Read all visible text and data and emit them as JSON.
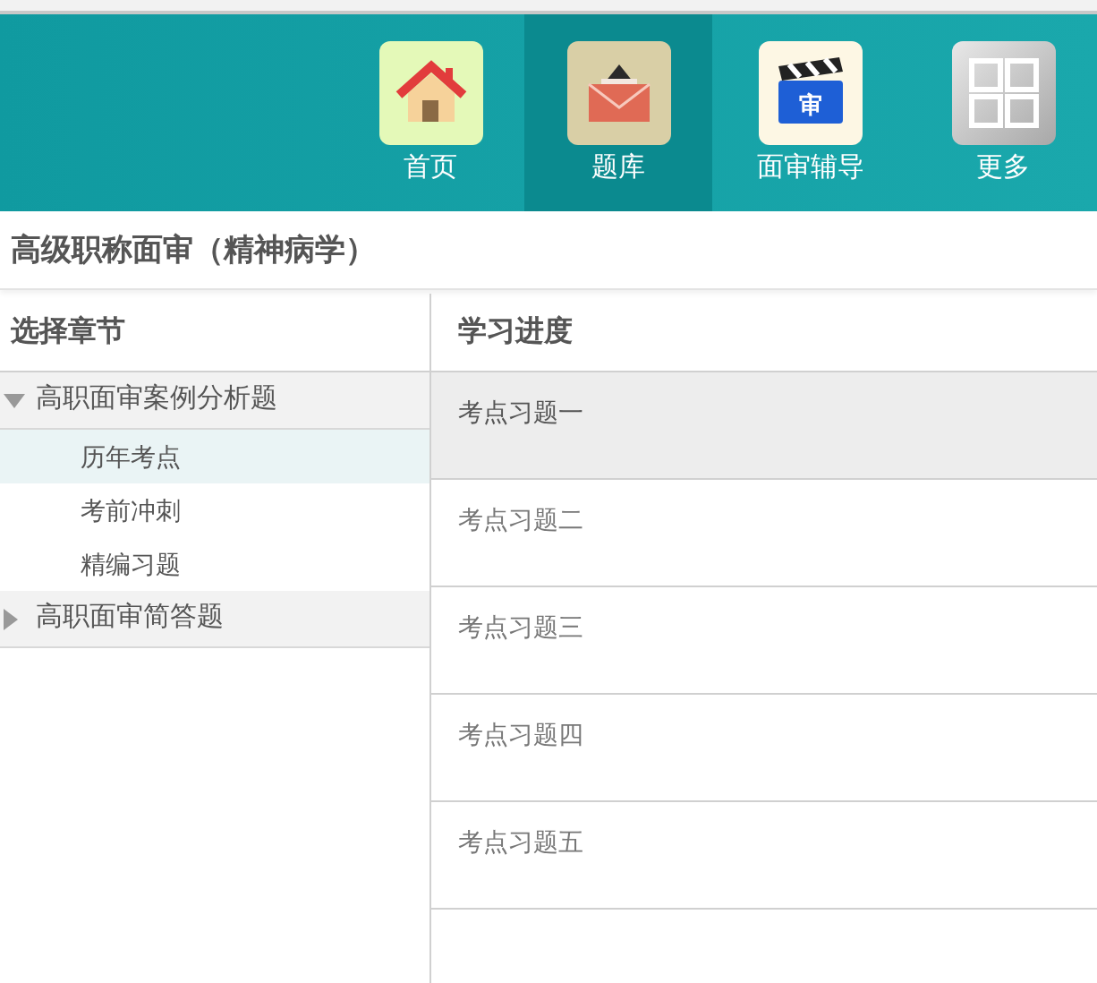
{
  "nav": [
    {
      "kind": "home",
      "label": "首页",
      "selected": false
    },
    {
      "kind": "mail",
      "label": "题库",
      "selected": true
    },
    {
      "kind": "video",
      "label": "面审辅导",
      "selected": false,
      "icon_text": "审"
    },
    {
      "kind": "more",
      "label": "更多",
      "selected": false
    }
  ],
  "title": "高级职称面审（精神病学）",
  "chapters": {
    "header": "选择章节",
    "items": [
      {
        "label": "高职面审案例分析题",
        "expanded": true,
        "children": [
          {
            "label": "历年考点",
            "selected": true
          },
          {
            "label": "考前冲刺",
            "selected": false
          },
          {
            "label": "精编习题",
            "selected": false
          }
        ]
      },
      {
        "label": "高职面审简答题",
        "expanded": false
      }
    ]
  },
  "progress": {
    "header": "学习进度",
    "items": [
      {
        "label": "考点习题一",
        "selected": true
      },
      {
        "label": "考点习题二",
        "selected": false
      },
      {
        "label": "考点习题三",
        "selected": false
      },
      {
        "label": "考点习题四",
        "selected": false
      },
      {
        "label": "考点习题五",
        "selected": false
      }
    ]
  }
}
